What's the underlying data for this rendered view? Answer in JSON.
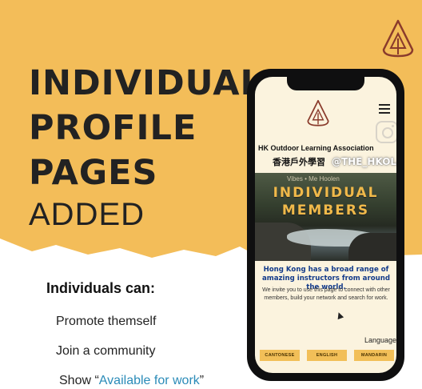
{
  "headline": {
    "line1": "INDIVIDUAL",
    "line2": "PROFILE",
    "line3": "PAGES",
    "line4": "ADDED"
  },
  "benefits": {
    "title": "Individuals can:",
    "items": [
      "Promote themself",
      "Join a community"
    ],
    "last_prefix": "Show “",
    "last_highlight": "Available for work",
    "last_suffix": "”",
    "highlight_color": "#2a8bb8"
  },
  "phone": {
    "org_name": "HK Outdoor Learning Association",
    "org_name_cn": "香港戶外學習",
    "handle": "@THE_HKOLA",
    "hero_sub": "Vibes • Me Hoolen",
    "hero_title_1": "INDIVIDUAL",
    "hero_title_2": "MEMBERS",
    "intro_bold": "Hong Kong has a broad range of amazing instructors from around the world.",
    "intro_text": "We invite you to use this page to connect with other members, build your network and search for work.",
    "language_label": "Language",
    "languages": [
      "CANTONESE",
      "ENGLISH",
      "MANDARIN"
    ]
  },
  "colors": {
    "banner": "#f3bd59",
    "accent_brown": "#8a3b2c"
  },
  "icons": [
    "ola-logo-icon",
    "menu-icon",
    "instagram-icon",
    "cursor-icon"
  ]
}
